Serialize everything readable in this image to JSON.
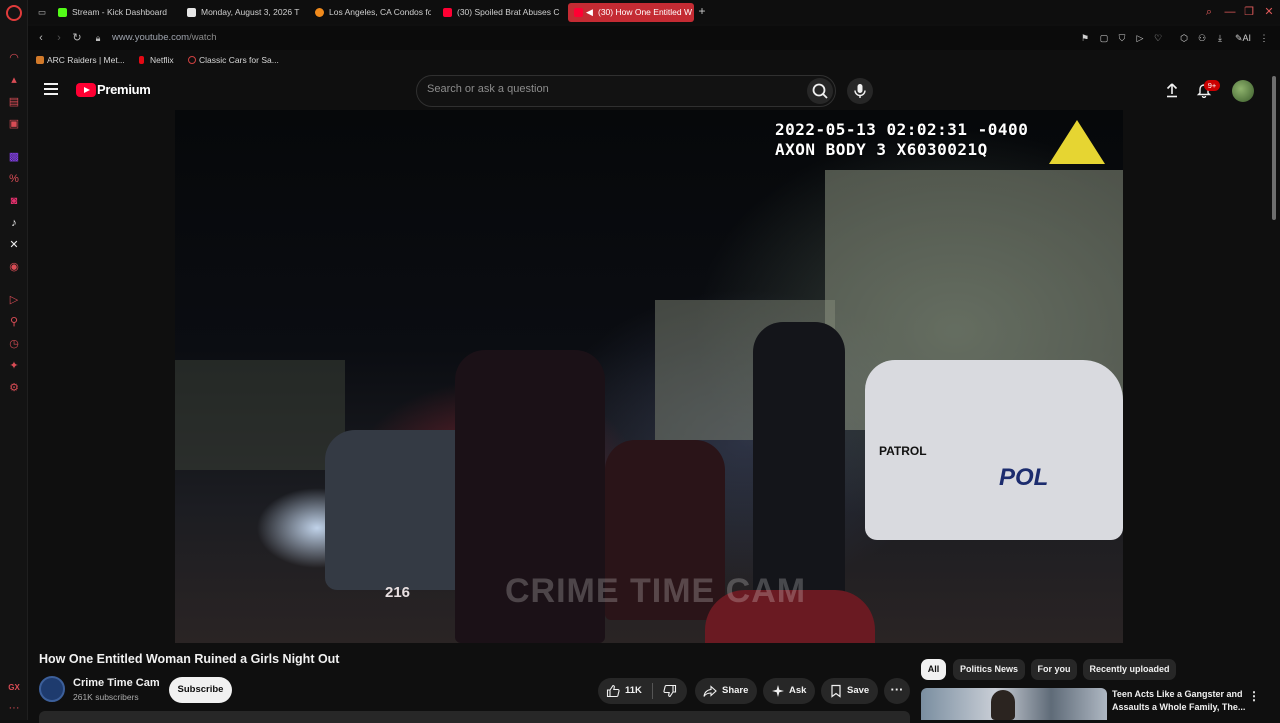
{
  "tabs": [
    {
      "label": "Stream - Kick Dashboard",
      "favicon_color": "#53fc18"
    },
    {
      "label": "Monday, August 3, 2026 T",
      "favicon_color": "#e6e6e6"
    },
    {
      "label": "Los Angeles, CA Condos fo",
      "favicon_color": "#f08a1c"
    },
    {
      "label": "(30) Spoiled Brat Abuses C",
      "favicon_color": "#ff0033"
    },
    {
      "label": "(30) How One Entitled W",
      "favicon_color": "#ff0033",
      "active": true
    }
  ],
  "address": {
    "url_domain": "www.youtube.com",
    "url_path": "/watch"
  },
  "bookmarks": [
    {
      "label": "ARC Raiders | Met...",
      "favicon_color": "#d27a2a"
    },
    {
      "label": "Netflix",
      "favicon_color": "#e50914"
    },
    {
      "label": "Classic Cars for Sa...",
      "favicon_color": "#d04040"
    }
  ],
  "header": {
    "brand": "Premium",
    "search_placeholder": "Search or ask a question",
    "notification_badge": "9+"
  },
  "video": {
    "timestamp_line1": "2022-05-13 02:02:31 -0400",
    "timestamp_line2": "AXON BODY 3 X6030021Q",
    "watermark": "CRIME TIME CAM",
    "car_text": "PATROL",
    "car_text2": "POL",
    "car_number": "216"
  },
  "info": {
    "title": "How One Entitled Woman Ruined a Girls Night Out",
    "channel_name": "Crime Time Cam",
    "subscribers": "261K subscribers",
    "subscribe_label": "Subscribe",
    "likes": "11K",
    "share_label": "Share",
    "ask_label": "Ask",
    "save_label": "Save"
  },
  "chips": [
    "All",
    "Politics News",
    "For you",
    "Recently uploaded"
  ],
  "recommended": [
    {
      "title": "Teen Acts Like a Gangster and Assaults a Whole Family, The..."
    }
  ],
  "colors": {
    "accent": "#ff0033",
    "opera_red": "#c42b33",
    "background": "#0f0f0f"
  }
}
